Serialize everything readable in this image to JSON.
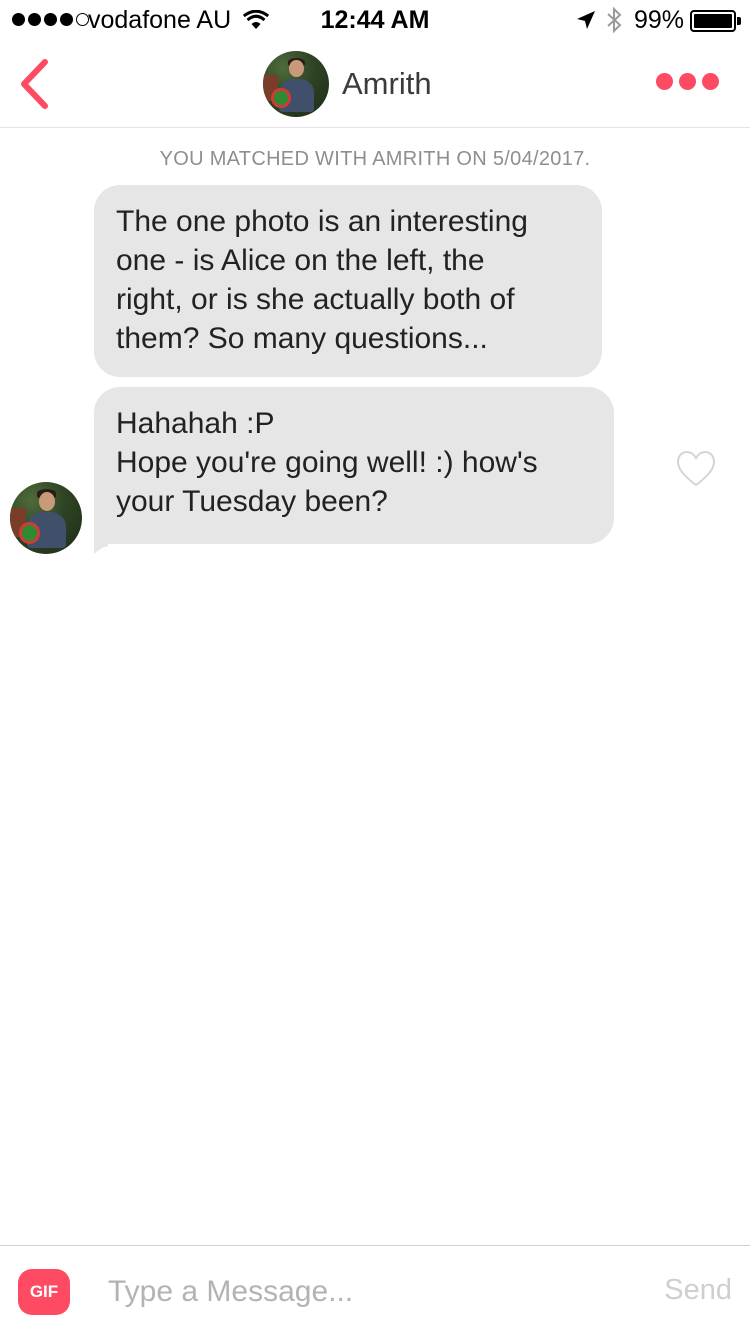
{
  "status_bar": {
    "carrier": "vodafone AU",
    "time": "12:44 AM",
    "battery": "99%",
    "battery_level": 0.99,
    "signal_bars": 4
  },
  "nav": {
    "name": "Amrith",
    "accent_color": "#fe4a63"
  },
  "chat": {
    "match_notice": "YOU MATCHED WITH AMRITH ON 5/04/2017.",
    "messages": [
      {
        "lines": [
          "The one photo is an interesting",
          "one - is Alice on the left, the",
          "right, or is she actually both of",
          "them? So many questions..."
        ]
      },
      {
        "lines": [
          "Hahahah :P",
          "Hope you're going well! :) how's",
          "your Tuesday been?"
        ]
      }
    ]
  },
  "composer": {
    "gif_label": "GIF",
    "placeholder": "Type a Message...",
    "send_label": "Send"
  }
}
